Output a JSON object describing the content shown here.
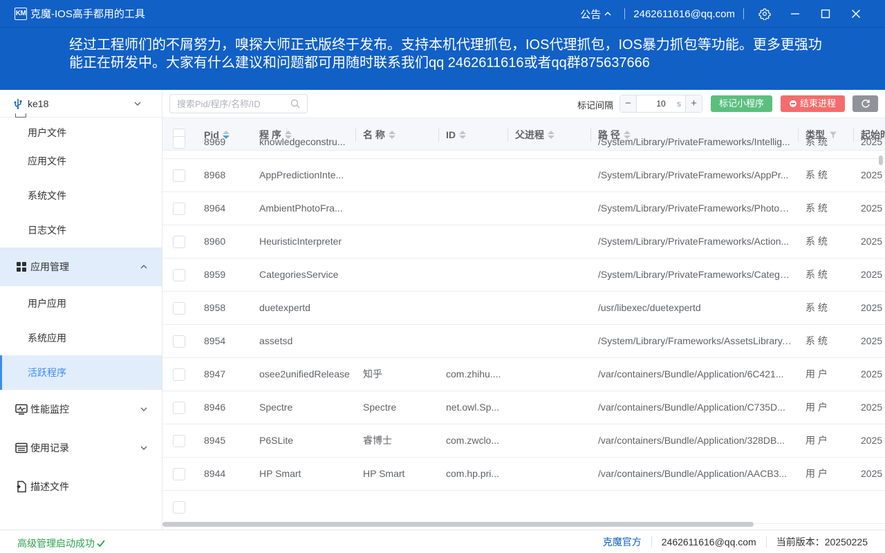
{
  "app": {
    "logo_text": "KM",
    "title": "克魔-IOS高手都用的工具"
  },
  "titlebar": {
    "notice_label": "公告",
    "email": "2462611616@qq.com"
  },
  "announcement": "经过工程师们的不屑努力，嗅探大师正式版终于发布。支持本机代理抓包，IOS代理抓包，IOS暴力抓包等功能。更多更强功能正在研发中。大家有什么建议和问题都可用随时联系我们qq 2462611616或者qq群875637666",
  "sidebar": {
    "device": "ke18",
    "file_items": [
      {
        "label": "用户文件"
      },
      {
        "label": "应用文件"
      },
      {
        "label": "系统文件"
      },
      {
        "label": "日志文件"
      }
    ],
    "app_mgmt": {
      "label": "应用管理",
      "icon": "grid-icon"
    },
    "app_items": [
      {
        "label": "用户应用",
        "active": false
      },
      {
        "label": "系统应用",
        "active": false
      },
      {
        "label": "活跃程序",
        "active": true
      }
    ],
    "perf": {
      "label": "性能监控",
      "icon": "monitor-chart-icon"
    },
    "usage": {
      "label": "使用记录",
      "icon": "list-icon"
    },
    "profile": {
      "label": "描述文件",
      "icon": "file-icon"
    }
  },
  "toolbar": {
    "search_placeholder": "搜索Pid/程序/名称/ID",
    "interval_label": "标记间隔",
    "interval_value": "10",
    "interval_unit": "s",
    "mark_button": "标记小程序",
    "end_button": "结束进程"
  },
  "table": {
    "columns": [
      "Pid",
      "程 序",
      "名 称",
      "ID",
      "父进程",
      "路 径",
      "类型",
      "起始时间"
    ],
    "rows": [
      {
        "pid": "8969",
        "program": "knowledgeconstru...",
        "name": "",
        "id": "",
        "parent": "",
        "path": "/System/Library/PrivateFrameworks/Intellig...",
        "type": "系 统",
        "start": "2025"
      },
      {
        "pid": "8968",
        "program": "AppPredictionInte...",
        "name": "",
        "id": "",
        "parent": "",
        "path": "/System/Library/PrivateFrameworks/AppPr...",
        "type": "系 统",
        "start": "2025"
      },
      {
        "pid": "8964",
        "program": "AmbientPhotoFra...",
        "name": "",
        "id": "",
        "parent": "",
        "path": "/System/Library/PrivateFrameworks/Photos...",
        "type": "系 统",
        "start": "2025"
      },
      {
        "pid": "8960",
        "program": "HeuristicInterpreter",
        "name": "",
        "id": "",
        "parent": "",
        "path": "/System/Library/PrivateFrameworks/Action...",
        "type": "系 统",
        "start": "2025"
      },
      {
        "pid": "8959",
        "program": "CategoriesService",
        "name": "",
        "id": "",
        "parent": "",
        "path": "/System/Library/PrivateFrameworks/Catego...",
        "type": "系 统",
        "start": "2025"
      },
      {
        "pid": "8958",
        "program": "duetexpertd",
        "name": "",
        "id": "",
        "parent": "",
        "path": "/usr/libexec/duetexpertd",
        "type": "系 统",
        "start": "2025"
      },
      {
        "pid": "8954",
        "program": "assetsd",
        "name": "",
        "id": "",
        "parent": "",
        "path": "/System/Library/Frameworks/AssetsLibrary....",
        "type": "系 统",
        "start": "2025"
      },
      {
        "pid": "8947",
        "program": "osee2unifiedRelease",
        "name": "知乎",
        "id": "com.zhihu....",
        "parent": "",
        "path": "/var/containers/Bundle/Application/6C421...",
        "type": "用 户",
        "start": "2025"
      },
      {
        "pid": "8946",
        "program": "Spectre",
        "name": "Spectre",
        "id": "net.owl.Sp...",
        "parent": "",
        "path": "/var/containers/Bundle/Application/C735D...",
        "type": "用 户",
        "start": "2025"
      },
      {
        "pid": "8945",
        "program": "P6SLite",
        "name": "睿博士",
        "id": "com.zwclo...",
        "parent": "",
        "path": "/var/containers/Bundle/Application/328DB...",
        "type": "用 户",
        "start": "2025"
      },
      {
        "pid": "8944",
        "program": "HP Smart",
        "name": "HP Smart",
        "id": "com.hp.pri...",
        "parent": "",
        "path": "/var/containers/Bundle/Application/AACB3...",
        "type": "用 户",
        "start": "2025"
      }
    ]
  },
  "statusbar": {
    "status": "高级管理启动成功",
    "official_link": "克魔官方",
    "email": "2462611616@qq.com",
    "version": "当前版本：20250225"
  },
  "colors": {
    "brand_blue": "#1160c6",
    "active_bg": "#e1edfb",
    "green": "#5bbf7e",
    "red": "#f56c6c",
    "gray": "#909399"
  }
}
